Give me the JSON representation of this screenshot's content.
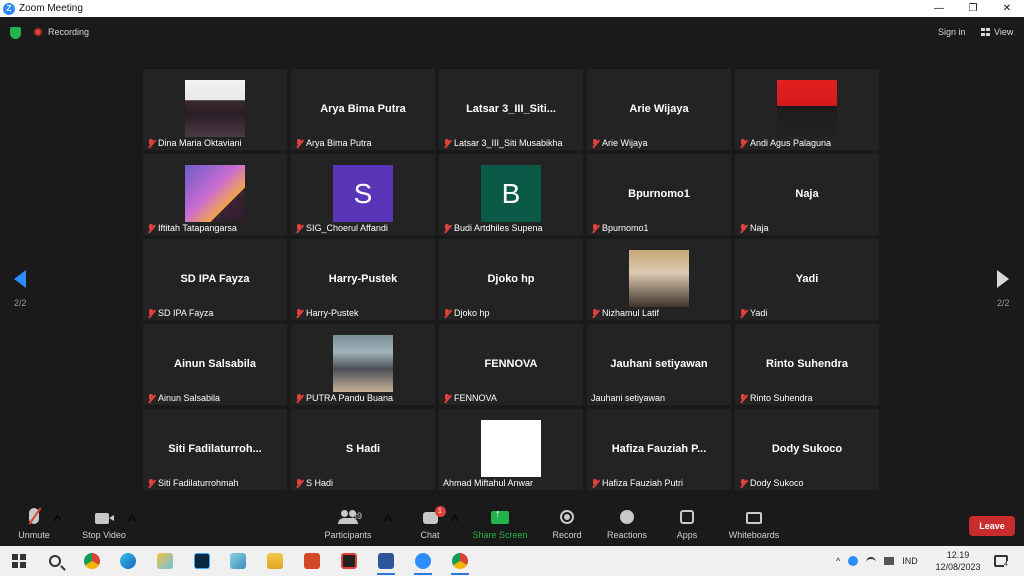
{
  "window": {
    "title": "Zoom Meeting",
    "controls": [
      "—",
      "❐",
      "✕"
    ]
  },
  "topbar": {
    "recording_label": "Recording",
    "signin_label": "Sign in",
    "view_label": "View"
  },
  "pagination": {
    "left": "2/2",
    "right": "2/2"
  },
  "tiles": [
    {
      "big": "",
      "avatar": "photo1",
      "label": "Dina Maria Oktaviani",
      "muted": true
    },
    {
      "big": "Arya Bima Putra",
      "avatar": "",
      "label": "Arya Bima Putra",
      "muted": true
    },
    {
      "big": "Latsar 3_III_Siti...",
      "avatar": "",
      "label": "Latsar 3_III_Siti Musabikha",
      "muted": true
    },
    {
      "big": "Arie Wijaya",
      "avatar": "",
      "label": "Arie Wijaya",
      "muted": true
    },
    {
      "big": "",
      "avatar": "photo2",
      "label": "Andi Agus Palaguna",
      "muted": true
    },
    {
      "big": "",
      "avatar": "photo3",
      "label": "Iftitah Tatapangarsa",
      "muted": true
    },
    {
      "big": "",
      "avatar": "letter",
      "letter": "S",
      "letter_bg": "#5b35b8",
      "label": "SIG_Choerul Affandi",
      "muted": true
    },
    {
      "big": "",
      "avatar": "letter",
      "letter": "B",
      "letter_bg": "#0b5a47",
      "label": "Budi Artdhiles Supena",
      "muted": true
    },
    {
      "big": "Bpurnomo1",
      "avatar": "",
      "label": "Bpurnomo1",
      "muted": true
    },
    {
      "big": "Naja",
      "avatar": "",
      "label": "Naja",
      "muted": true
    },
    {
      "big": "SD IPA Fayza",
      "avatar": "",
      "label": "SD IPA Fayza",
      "muted": true
    },
    {
      "big": "Harry-Pustek",
      "avatar": "",
      "label": "Harry-Pustek",
      "muted": true
    },
    {
      "big": "Djoko hp",
      "avatar": "",
      "label": "Djoko hp",
      "muted": true
    },
    {
      "big": "",
      "avatar": "photo4",
      "label": "Nizhamul Latif",
      "muted": true
    },
    {
      "big": "Yadi",
      "avatar": "",
      "label": "Yadi",
      "muted": true
    },
    {
      "big": "Ainun Salsabila",
      "avatar": "",
      "label": "Ainun Salsabila",
      "muted": true
    },
    {
      "big": "",
      "avatar": "photo5",
      "label": "PUTRA Pandu Buana",
      "muted": true
    },
    {
      "big": "FENNOVA",
      "avatar": "",
      "label": "FENNOVA",
      "muted": true
    },
    {
      "big": "Jauhani setiyawan",
      "avatar": "",
      "label": "Jauhani setiyawan",
      "muted": false
    },
    {
      "big": "Rinto Suhendra",
      "avatar": "",
      "label": "Rinto Suhendra",
      "muted": true
    },
    {
      "big": "Siti  Fadilaturroh...",
      "avatar": "",
      "label": "Siti Fadilaturrohmah",
      "muted": true
    },
    {
      "big": "S Hadi",
      "avatar": "",
      "label": "S Hadi",
      "muted": true
    },
    {
      "big": "",
      "avatar": "sketch",
      "label": "Ahmad Miftahul Anwar",
      "muted": false
    },
    {
      "big": "Hafiza  Fauziah  P...",
      "avatar": "",
      "label": "Hafiza Fauziah Putri",
      "muted": true
    },
    {
      "big": "Dody Sukoco",
      "avatar": "",
      "label": "Dody Sukoco",
      "muted": true
    }
  ],
  "toolbar": {
    "unmute": "Unmute",
    "stop_video": "Stop Video",
    "participants": "Participants",
    "participant_count": "39",
    "chat": "Chat",
    "chat_badge": "1",
    "share_screen": "Share Screen",
    "record": "Record",
    "reactions": "Reactions",
    "apps": "Apps",
    "whiteboards": "Whiteboards",
    "leave": "Leave",
    "caret": "^"
  },
  "taskbar": {
    "lang": "IND",
    "time": "12.19",
    "date": "12/08/2023",
    "notif_count": "4",
    "tray_chevron": "^"
  },
  "colors": {
    "accent": "#2d8cff",
    "share_green": "#23b34a",
    "leave_red": "#c92c2c",
    "mute_red": "#e0413a"
  }
}
